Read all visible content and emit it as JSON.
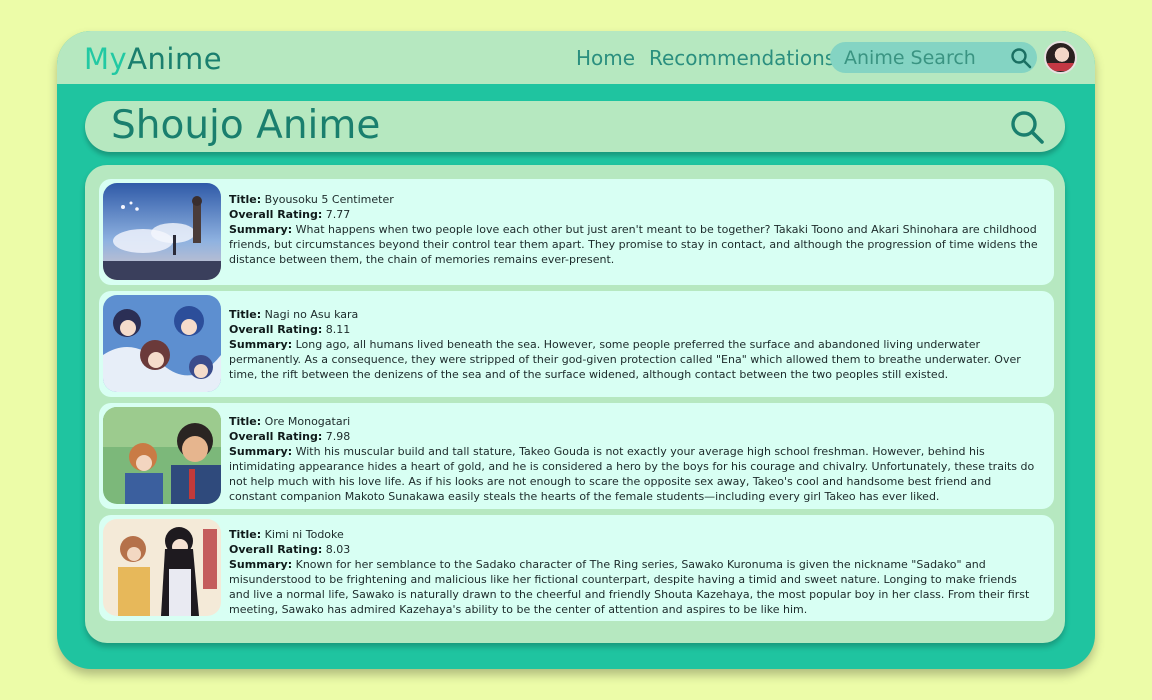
{
  "header": {
    "logo_my": "My",
    "logo_anime": "Anime",
    "nav": {
      "home": "Home",
      "recommendations": "Recommendations"
    },
    "search_placeholder": "Anime Search"
  },
  "page": {
    "title": "Shoujo Anime"
  },
  "labels": {
    "title": "Title:",
    "rating": "Overall Rating:",
    "summary": "Summary:"
  },
  "results": [
    {
      "title": "Byousoku 5 Centimeter",
      "rating": "7.77",
      "summary": "What happens when two people love each other but just aren't meant to be together? Takaki Toono and Akari Shinohara are childhood friends, but circumstances beyond their control tear them apart. They promise to stay in contact, and although the progression of time widens the distance between them, the chain of memories remains ever-present."
    },
    {
      "title": "Nagi no Asu kara",
      "rating": "8.11",
      "summary": "Long ago, all humans lived beneath the sea. However, some people preferred the surface and abandoned living underwater permanently. As a consequence, they were stripped of their god-given protection called \"Ena\" which allowed them to breathe underwater. Over time, the rift between the denizens of the sea and of the surface widened, although contact between the two peoples still existed."
    },
    {
      "title": "Ore Monogatari",
      "rating": "7.98",
      "summary": "With his muscular build and tall stature, Takeo Gouda is not exactly your average high school freshman. However, behind his intimidating appearance hides a heart of gold, and he is considered a hero by the boys for his courage and chivalry. Unfortunately, these traits do not help much with his love life. As if his looks are not enough to scare the opposite sex away, Takeo's cool and handsome best friend and constant companion Makoto Sunakawa easily steals the hearts of the female students—including every girl Takeo has ever liked."
    },
    {
      "title": "Kimi ni Todoke",
      "rating": "8.03",
      "summary": "Known for her semblance to the Sadako character of The Ring series, Sawako Kuronuma is given the nickname \"Sadako\" and misunderstood to be frightening and malicious like her fictional counterpart, despite having a timid and sweet nature. Longing to make friends and live a normal life, Sawako is naturally drawn to the cheerful and friendly Shouta Kazehaya, the most popular boy in her class. From their first meeting, Sawako has admired Kazehaya's ability to be the center of attention and aspires to be like him."
    }
  ],
  "colors": {
    "background": "#ecfca8",
    "app": "#1fc4a0",
    "panel": "#b6e8c0",
    "card": "#d8fff3",
    "logo_accent": "#22c9a3",
    "text_dark_teal": "#1a7f6e"
  },
  "icons": {
    "search": "search-icon"
  }
}
